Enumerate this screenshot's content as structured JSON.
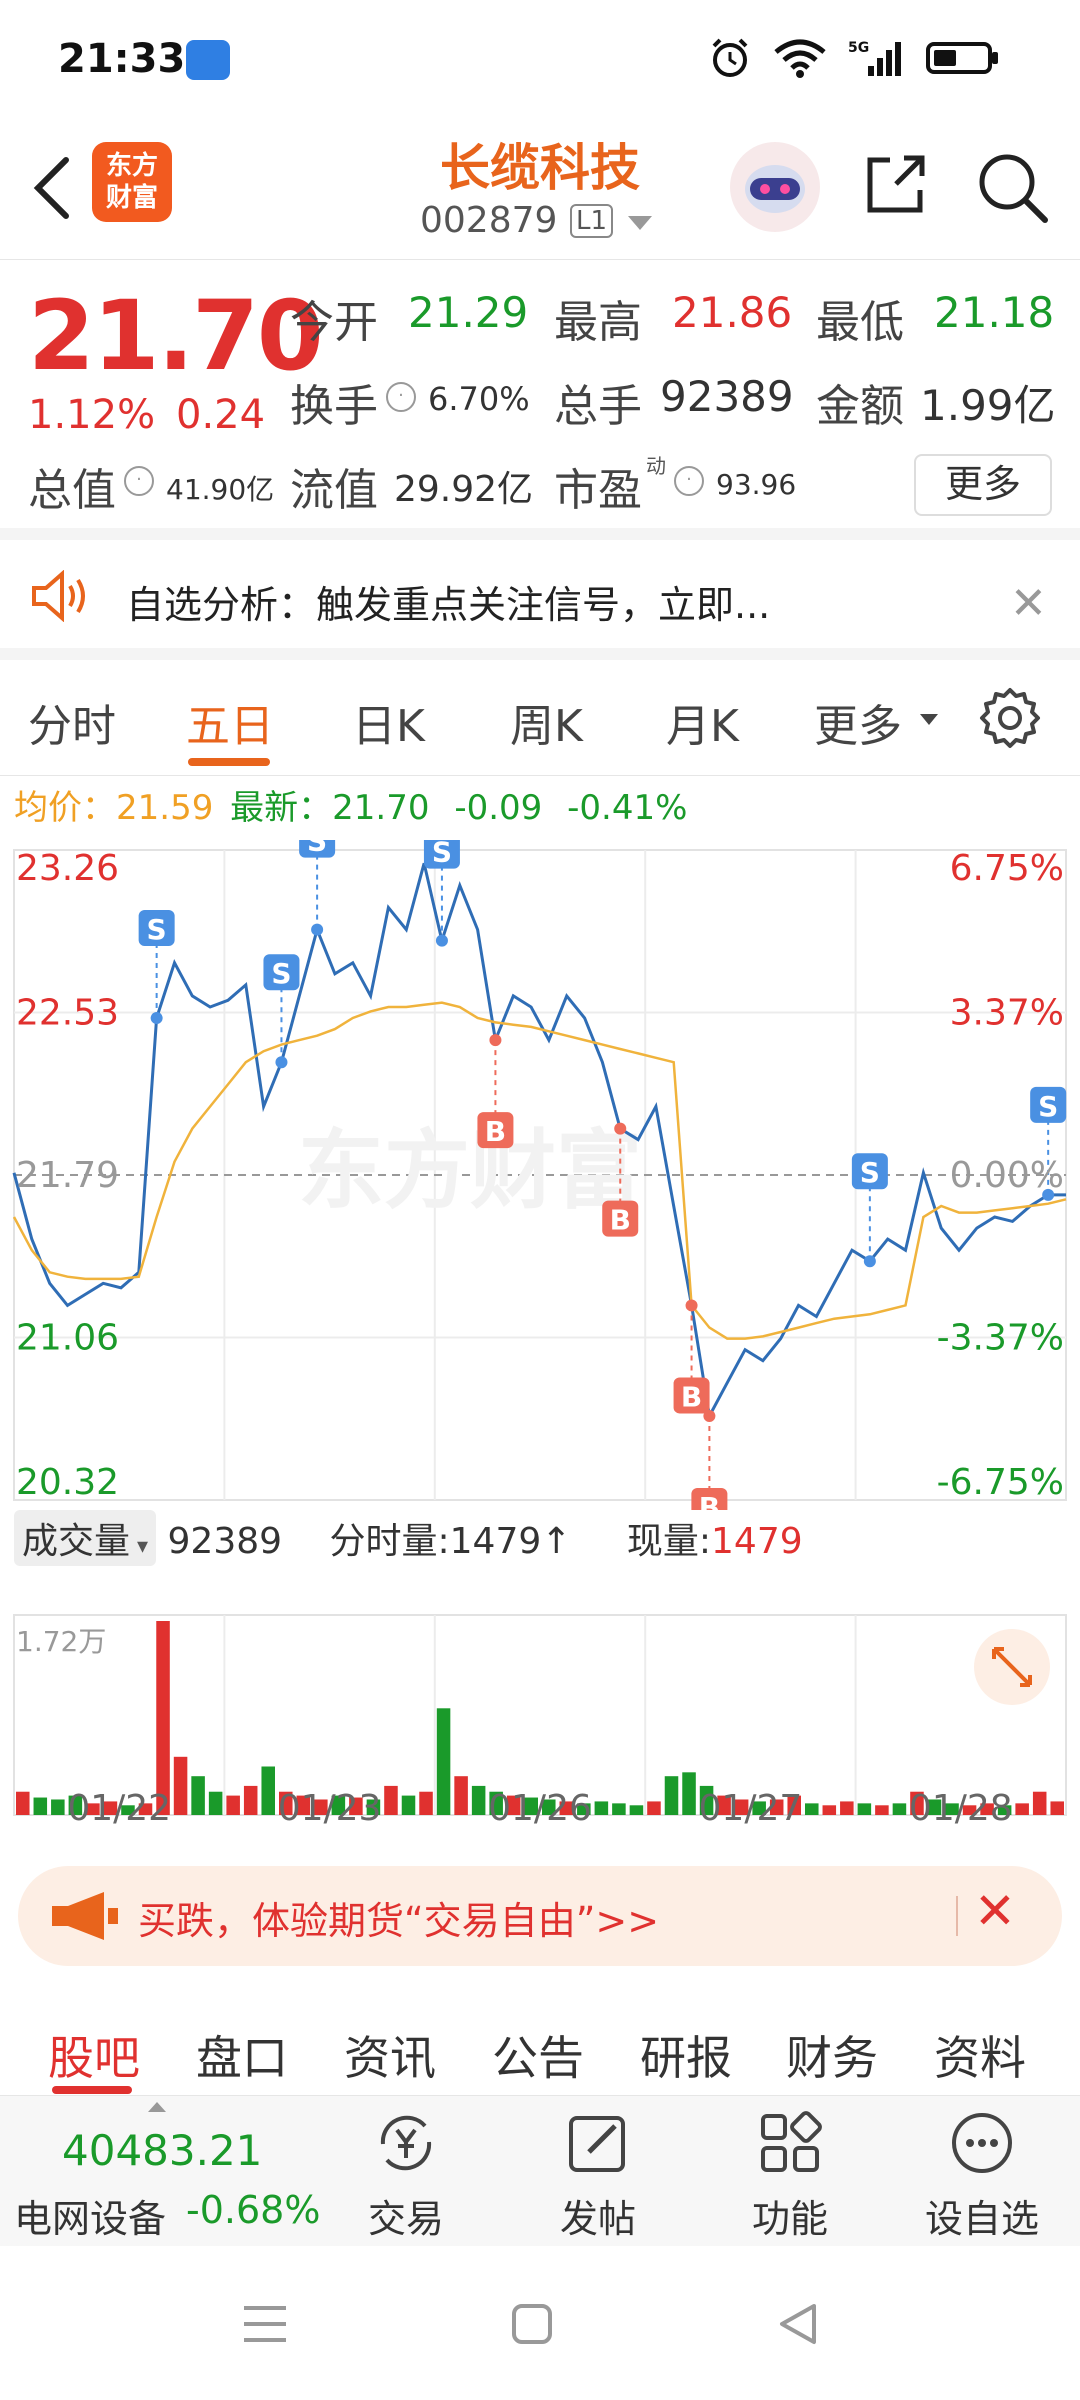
{
  "status": {
    "time": "21:33"
  },
  "header": {
    "logo_line1": "东方",
    "logo_line2": "财富",
    "stock_name": "长缆科技",
    "stock_code": "002879",
    "level_badge": "L1"
  },
  "quote": {
    "price": "21.70",
    "pct": "1.12%",
    "change": "0.24",
    "open_label": "今开",
    "open": "21.29",
    "high_label": "最高",
    "high": "21.86",
    "low_label": "最低",
    "low": "21.18",
    "turnover_label": "换手",
    "turnover": "6.70%",
    "volume_label": "总手",
    "volume": "92389",
    "amount_label": "金额",
    "amount": "1.99亿",
    "mcap_label": "总值",
    "mcap": "41.90亿",
    "float_label": "流值",
    "float": "29.92亿",
    "pe_label": "市盈",
    "pe_sup": "动",
    "pe": "93.96",
    "more": "更多"
  },
  "notice": {
    "text": "自选分析：触发重点关注信号，立即..."
  },
  "period_tabs": [
    "分时",
    "五日",
    "日K",
    "周K",
    "月K",
    "更多"
  ],
  "avg_line": {
    "avg_label": "均价：",
    "avg": "21.59",
    "latest_label": "最新：",
    "latest": "21.70",
    "chg": "-0.09",
    "pct": "-0.41%"
  },
  "chart_data": {
    "type": "line",
    "y_labels_left": [
      "23.26",
      "22.53",
      "21.79",
      "21.06",
      "20.32"
    ],
    "y_labels_right": [
      "6.75%",
      "3.37%",
      "0.00%",
      "-3.37%",
      "-6.75%"
    ],
    "ylim": [
      20.32,
      23.26
    ],
    "baseline": 21.79,
    "x_labels": [
      "01/22",
      "01/23",
      "01/26",
      "01/27",
      "01/28"
    ],
    "watermark": "东方财富",
    "series": [
      {
        "values": [
          21.8,
          21.5,
          21.3,
          21.2,
          21.25,
          21.3,
          21.28,
          21.35,
          22.5,
          22.75,
          22.6,
          22.55,
          22.58,
          22.65,
          22.1,
          22.3,
          22.6,
          22.9,
          22.7,
          22.75,
          22.6,
          23.0,
          22.9,
          23.2,
          22.85,
          23.1,
          22.9,
          22.4,
          22.6,
          22.55,
          22.4,
          22.6,
          22.5,
          22.3,
          22.0,
          21.95,
          22.1,
          21.65,
          21.2,
          20.7,
          20.85,
          21.0,
          20.95,
          21.05,
          21.2,
          21.15,
          21.3,
          21.45,
          21.4,
          21.5,
          21.45,
          21.8,
          21.55,
          21.45,
          21.55,
          21.6,
          21.58,
          21.65,
          21.7,
          21.7
        ]
      },
      {
        "values": [
          21.6,
          21.45,
          21.35,
          21.33,
          21.32,
          21.32,
          21.32,
          21.33,
          21.6,
          21.85,
          22.0,
          22.1,
          22.2,
          22.3,
          22.35,
          22.38,
          22.4,
          22.42,
          22.45,
          22.5,
          22.53,
          22.55,
          22.55,
          22.56,
          22.57,
          22.55,
          22.5,
          22.48,
          22.47,
          22.46,
          22.44,
          22.42,
          22.4,
          22.38,
          22.36,
          22.34,
          22.32,
          22.3,
          21.2,
          21.1,
          21.05,
          21.05,
          21.06,
          21.08,
          21.1,
          21.12,
          21.14,
          21.15,
          21.16,
          21.18,
          21.2,
          21.6,
          21.65,
          21.62,
          21.62,
          21.63,
          21.64,
          21.65,
          21.66,
          21.68
        ]
      }
    ],
    "markers": [
      "S",
      "S",
      "S",
      "S",
      "B",
      "B",
      "B",
      "B",
      "S",
      "S"
    ]
  },
  "volume_header": {
    "selector": "成交量",
    "total": "92389",
    "tick_label": "分时量:",
    "tick": "1479↑",
    "now_label": "现量:",
    "now": "1479",
    "max_label": "1.72万"
  },
  "volume_data": {
    "values": [
      0.12,
      0.09,
      0.08,
      0.1,
      0.06,
      0.07,
      0.05,
      0.06,
      1.0,
      0.3,
      0.2,
      0.12,
      0.1,
      0.15,
      0.25,
      0.12,
      0.1,
      0.08,
      0.1,
      0.09,
      0.08,
      0.15,
      0.1,
      0.12,
      0.55,
      0.2,
      0.15,
      0.12,
      0.1,
      0.09,
      0.08,
      0.07,
      0.06,
      0.07,
      0.06,
      0.05,
      0.07,
      0.2,
      0.22,
      0.15,
      0.1,
      0.08,
      0.07,
      0.08,
      0.1,
      0.06,
      0.05,
      0.07,
      0.06,
      0.05,
      0.06,
      0.12,
      0.08,
      0.06,
      0.05,
      0.06,
      0.05,
      0.06,
      0.12,
      0.07
    ]
  },
  "promo": {
    "text": "买跌，体验期货“交易自由”>>"
  },
  "bottom_tabs": [
    "股吧",
    "盘口",
    "资讯",
    "公告",
    "研报",
    "财务",
    "资料"
  ],
  "toolbar": {
    "index_value": "40483.21",
    "index_name": "电网设备",
    "index_change": "-0.68%",
    "trade": "交易",
    "post": "发帖",
    "function": "功能",
    "watch": "设自选"
  },
  "colors": {
    "brand": "#e8641c",
    "up": "#e0312f",
    "down": "#1a9a2a",
    "price_line": "#2f6db5",
    "avg_line": "#f0b33c"
  }
}
